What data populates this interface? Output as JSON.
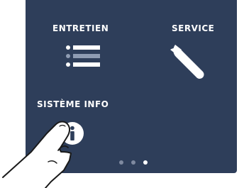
{
  "menu": {
    "items": [
      {
        "label": "ENTRETIEN",
        "icon": "list-icon"
      },
      {
        "label": "SERVICE",
        "icon": "wrench-icon"
      },
      {
        "label": "SISTÈME INFO",
        "icon": "info-icon"
      }
    ]
  },
  "pager": {
    "page_count": 3,
    "active_page": 3
  },
  "colors": {
    "background": "#2e3e5a",
    "foreground": "#ffffff",
    "dot_inactive": "#7f8aa0",
    "dot_active": "#ffffff"
  }
}
